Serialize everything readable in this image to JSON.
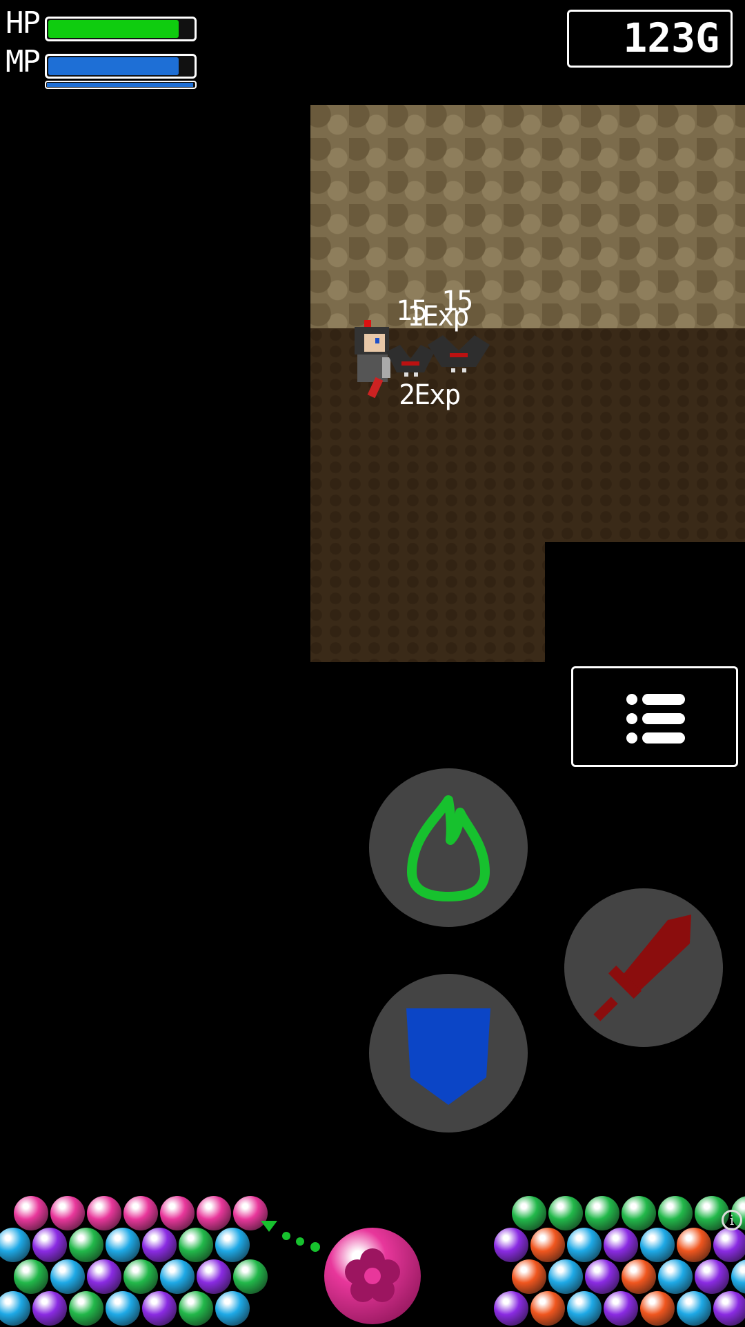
{
  "hud": {
    "hp_label": "HP",
    "mp_label": "MP",
    "hp_fraction": 0.92,
    "mp_fraction": 0.92,
    "exp_fraction": 1.0,
    "gold": "123G"
  },
  "colors": {
    "hp": "#0fcc0f",
    "mp": "#1e6fd6",
    "skill_flame": "#17c12e",
    "shield": "#0b45c6",
    "sword": "#8b0d0d",
    "action_button_bg": "#444444"
  },
  "combat_text": {
    "damage_a": "15",
    "damage_b": "15",
    "exp_a": "1Exp",
    "exp_b": "2Exp"
  },
  "icons": {
    "menu": "list-icon",
    "skill": "flame-icon",
    "defend": "shield-icon",
    "attack": "sword-icon",
    "info": "info-icon"
  },
  "info_glyph": "i",
  "orb_colors": [
    "#e8379b",
    "#8a2be2",
    "#22b84a",
    "#1ea9e6",
    "#f0561f"
  ],
  "shooter_orb_color": "#e8379b"
}
